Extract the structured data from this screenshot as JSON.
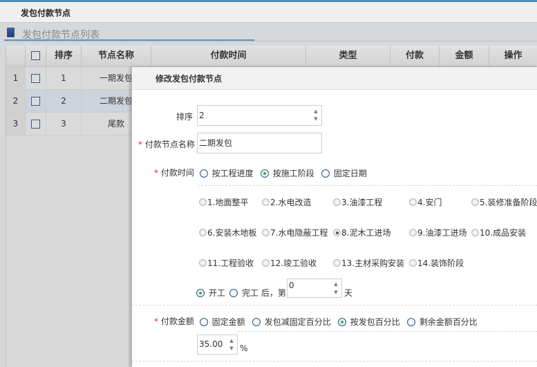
{
  "page": {
    "title": "发包付款节点",
    "panel_title": "发包付款节点列表"
  },
  "table": {
    "columns": [
      "排序",
      "节点名称",
      "付款时间",
      "类型",
      "付款",
      "金额",
      "操作"
    ],
    "rows": [
      {
        "num": "1",
        "order": "1",
        "name": "一期发包"
      },
      {
        "num": "2",
        "order": "2",
        "name": "二期发包"
      },
      {
        "num": "3",
        "order": "3",
        "name": "尾款"
      }
    ],
    "selected_row": 2
  },
  "modal": {
    "title": "修改发包付款节点",
    "order_label": "排序",
    "order_value": "2",
    "name_label": "付款节点名称",
    "name_value": "二期发包",
    "time_label": "付款时间",
    "time_options": [
      "按工程进度",
      "按施工阶段",
      "固定日期"
    ],
    "time_selected": 1,
    "stages": [
      "1.地面整平",
      "2.水电改造",
      "3.油漆工程",
      "4.安门",
      "5.装修准备阶段",
      "6.安装木地板",
      "7.水电隐蔽工程",
      "8.泥木工进场",
      "9.油漆工进场",
      "10.成品安装",
      "11.工程验收",
      "12.竣工验收",
      "13.主材采购安装",
      "14.装饰阶段"
    ],
    "stage_selected": 7,
    "start_label": "开工",
    "finish_label": "完工 后，第",
    "days_value": "0",
    "days_unit": "天",
    "start_selected": true,
    "amount_label": "付款金额",
    "amount_options": [
      "固定金额",
      "发包减固定百分比",
      "按发包百分比",
      "剩余金额百分比"
    ],
    "amount_selected": 2,
    "percent_value": "35.00",
    "percent_unit": "%"
  },
  "required_mark": "*",
  "colors": {
    "accent": "#5b95c0",
    "radio_on": "#2bb34a",
    "required": "#e23"
  }
}
